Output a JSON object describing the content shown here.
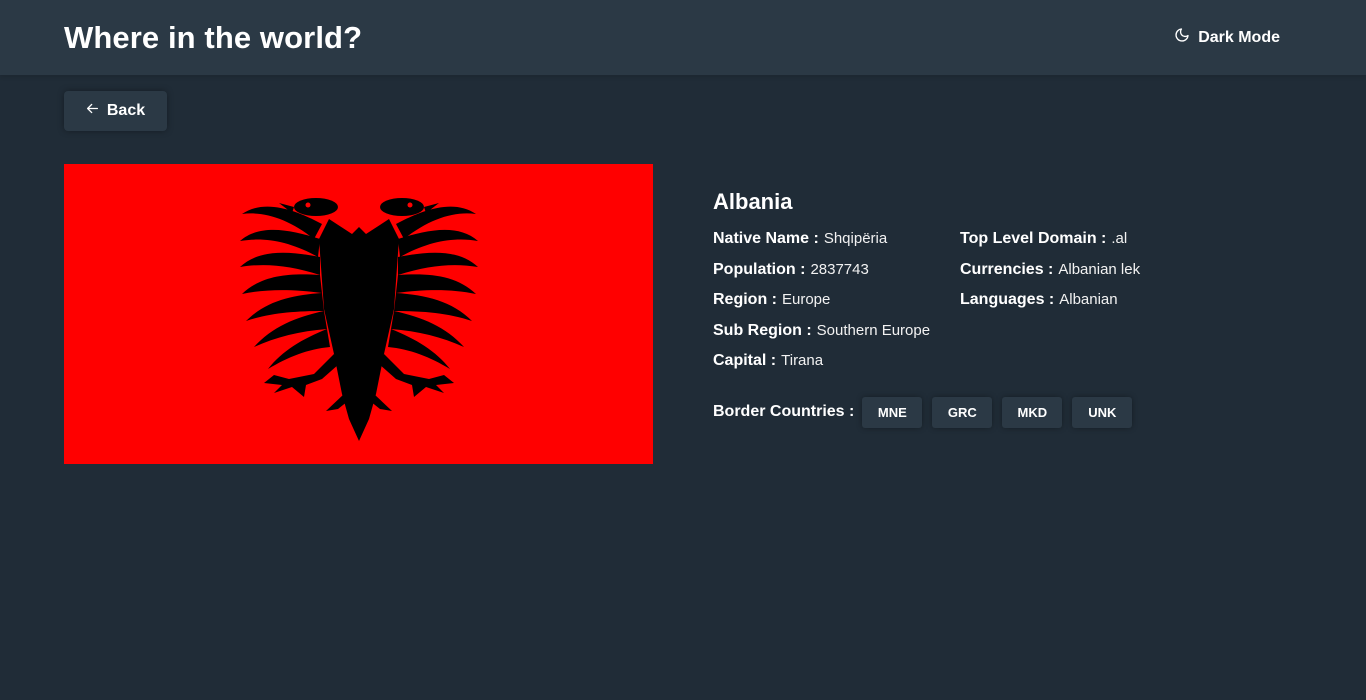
{
  "header": {
    "title": "Where in the world?",
    "mode_label": "Dark Mode",
    "mode_icon": "moon-icon"
  },
  "back": {
    "label": "Back",
    "icon": "arrow-left-icon"
  },
  "flag": {
    "icon": "albania-flag",
    "background": "#ff0000",
    "emblem": "#000000"
  },
  "country": {
    "name": "Albania",
    "native_name": {
      "label": "Native Name :",
      "value": "Shqipëria"
    },
    "population": {
      "label": "Population :",
      "value": "2837743"
    },
    "region": {
      "label": "Region :",
      "value": "Europe"
    },
    "sub_region": {
      "label": "Sub Region :",
      "value": "Southern Europe"
    },
    "capital": {
      "label": "Capital :",
      "value": "Tirana"
    },
    "tld": {
      "label": "Top Level Domain :",
      "value": ".al"
    },
    "currencies": {
      "label": "Currencies :",
      "value": "Albanian lek"
    },
    "languages": {
      "label": "Languages :",
      "value": "Albanian"
    },
    "borders": {
      "label": "Border Countries :",
      "items": [
        "MNE",
        "GRC",
        "MKD",
        "UNK"
      ]
    }
  },
  "colors": {
    "background": "#202c37",
    "element": "#2b3945",
    "text": "#ffffff"
  }
}
